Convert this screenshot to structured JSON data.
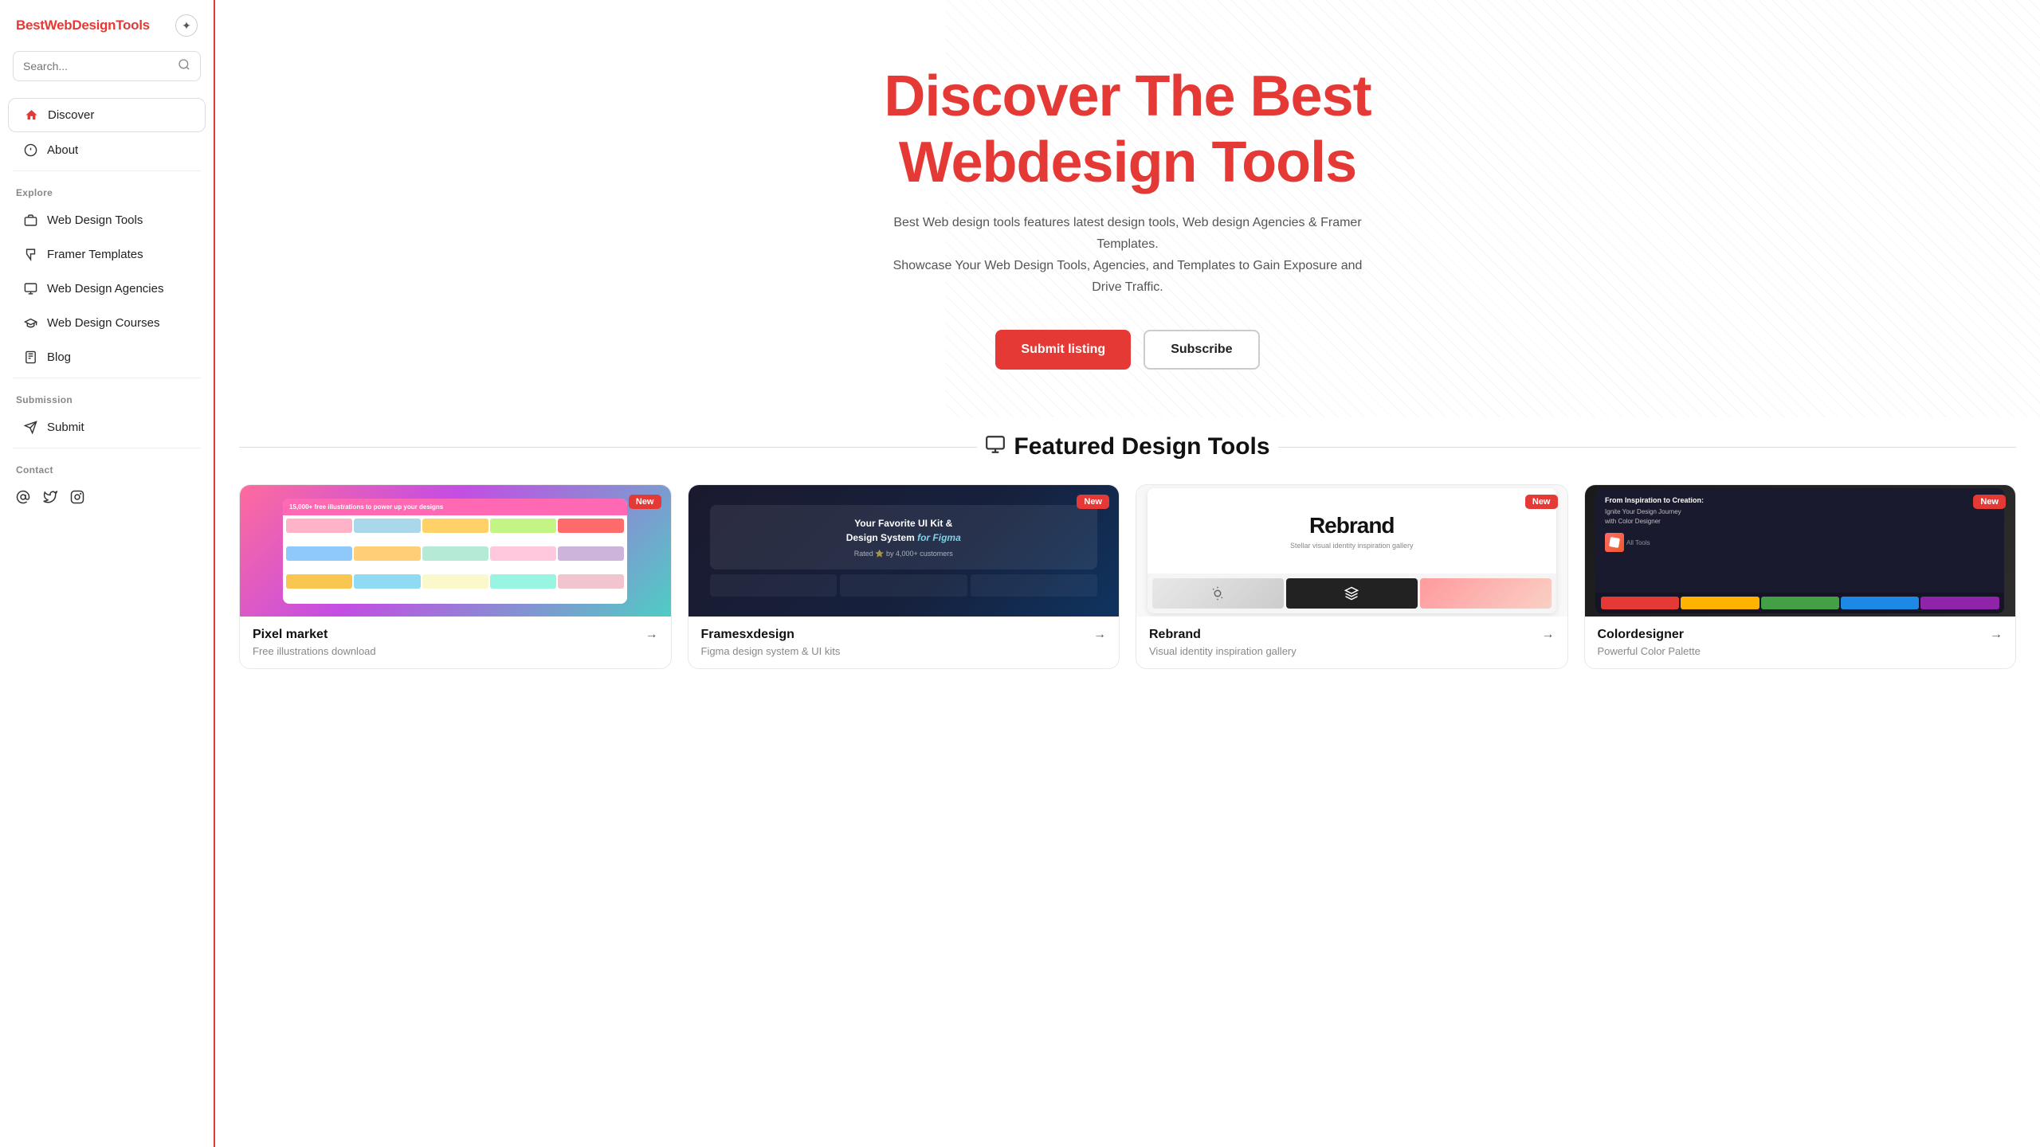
{
  "sidebar": {
    "logo": {
      "prefix": "Best",
      "highlight": "Web",
      "suffix": "DesignTools"
    },
    "search_placeholder": "Search...",
    "nav_items": [
      {
        "id": "discover",
        "label": "Discover",
        "icon": "home",
        "active": true
      },
      {
        "id": "about",
        "label": "About",
        "icon": "info",
        "active": false
      }
    ],
    "explore_label": "Explore",
    "explore_items": [
      {
        "id": "web-design-tools",
        "label": "Web Design Tools",
        "icon": "briefcase"
      },
      {
        "id": "framer-templates",
        "label": "Framer Templates",
        "icon": "grid"
      },
      {
        "id": "web-design-agencies",
        "label": "Web Design Agencies",
        "icon": "monitor"
      },
      {
        "id": "web-design-courses",
        "label": "Web Design Courses",
        "icon": "graduation"
      },
      {
        "id": "blog",
        "label": "Blog",
        "icon": "document"
      }
    ],
    "submission_label": "Submission",
    "submission_items": [
      {
        "id": "submit",
        "label": "Submit",
        "icon": "send"
      }
    ],
    "contact_label": "Contact",
    "social_icons": [
      "email",
      "twitter",
      "instagram"
    ]
  },
  "hero": {
    "title_line1": "Discover The Best",
    "title_highlight": "Webdesign",
    "title_line2_suffix": " Tools",
    "description": "Best Web design tools features latest design tools, Web design Agencies & Framer Templates.\nShowcase Your Web Design Tools, Agencies, and Templates to Gain Exposure and Drive Traffic.",
    "btn_submit": "Submit listing",
    "btn_subscribe": "Subscribe"
  },
  "featured": {
    "section_title": "Featured Design Tools",
    "cards": [
      {
        "id": "pixel-market",
        "title": "Pixel market",
        "description": "Free illustrations download",
        "badge": "New",
        "bg": "pixel"
      },
      {
        "id": "framesxdesign",
        "title": "Framesxdesign",
        "description": "Figma design system & UI kits",
        "badge": "New",
        "bg": "frames"
      },
      {
        "id": "rebrand",
        "title": "Rebrand",
        "description": "Visual identity inspiration gallery",
        "badge": "New",
        "bg": "rebrand"
      },
      {
        "id": "colordesigner",
        "title": "Colordesigner",
        "description": "Powerful Color Palette",
        "badge": "New",
        "bg": "colordesigner"
      }
    ]
  }
}
